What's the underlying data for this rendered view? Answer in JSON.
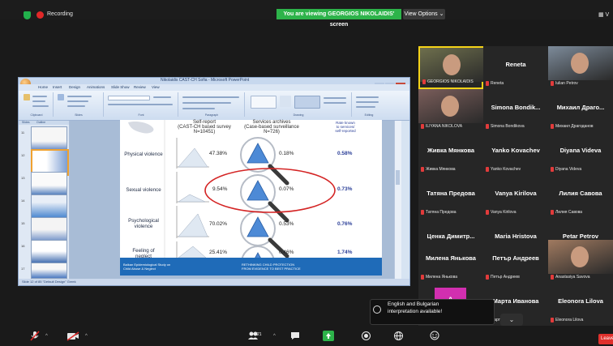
{
  "topbar": {
    "recording_label": "Recording",
    "viewing_banner": "You are viewing GEORGIOS NIKOLAIDIS' screen",
    "view_options": "View Options ⌄",
    "view_right": "▦ V"
  },
  "shared_screen": {
    "window_title": "Nikolaidis CAST-CH Sofia - Microsoft PowerPoint",
    "tabs": [
      "Home",
      "Insert",
      "Design",
      "Animations",
      "Slide Show",
      "Review",
      "View"
    ],
    "ribbon_groups": [
      "Clipboard",
      "Slides",
      "Font",
      "Paragraph",
      "Drawing",
      "Editing"
    ],
    "left_tabs": [
      "Slides",
      "Outline"
    ],
    "thumb_numbers": [
      "11",
      "12",
      "13",
      "14",
      "15",
      "16",
      "17"
    ],
    "status": "Slide 12 of 85   \"Default Design\"   Greek",
    "slide": {
      "col1_title": "Self-report\n(CAST-CH based survey\nN=10451)",
      "col2_title": "Services archives\n(Case-based surveillance\nN=726)",
      "col3_title": "Rate known\nto services/\nself-reported",
      "rows": [
        {
          "label": "Physical violence",
          "self": "47.38%",
          "services": "0.18%",
          "rate": "0.58%"
        },
        {
          "label": "Sexual violence",
          "self": "9.54%",
          "services": "0.07%",
          "rate": "0.73%"
        },
        {
          "label": "Psychological\nviolence",
          "self": "70.02%",
          "services": "0.53%",
          "rate": "0.76%"
        },
        {
          "label": "Feeling of\nneglect",
          "self": "25.41%",
          "services": "0.46%",
          "rate": "1.74%"
        }
      ],
      "footer_left": "Balkan Epidemiological Study on\nChild Abuse & Neglect",
      "footer_right": "RETHINKING CHILD PROTECTION\nFROM EVIDENCE TO BEST PRACTICE"
    }
  },
  "participants": [
    {
      "name": "",
      "small": "GEORGIOS NIKOLAIDIS",
      "photo": true
    },
    {
      "name": "Reneta",
      "small": "Reneta"
    },
    {
      "name": "",
      "small": "Iulian Petrov",
      "photo": true
    },
    {
      "name": "",
      "small": "ILIYANA NIKOLOVA",
      "photo": true
    },
    {
      "name": "Simona Bondik...",
      "small": "Simona Bondikova"
    },
    {
      "name": "Михаил Драго...",
      "small": "Михаил Драгоданов"
    },
    {
      "name": "Живка Мянкова",
      "small": "Живка Мянкова"
    },
    {
      "name": "Yanko Kovachev",
      "small": "Yanko Kovachev"
    },
    {
      "name": "Diyana Videva",
      "small": "Diyana Videva"
    },
    {
      "name": "Татяна Предова",
      "small": "Татяна Предова"
    },
    {
      "name": "Vanya Kirilova",
      "small": "Vanya Kirilova"
    },
    {
      "name": "Лилия Савова",
      "small": "Лилия Савова"
    },
    {
      "name": "Ценка Димитр...",
      "small": "Ценка Димитрова"
    },
    {
      "name": "Maria Hristova",
      "small": "Maria Hristova"
    },
    {
      "name": "Petar Petrov",
      "small": "Petar Petrov"
    },
    {
      "name": "Милена Янькова",
      "small": "Милена Янькова"
    },
    {
      "name": "Петър Андреев",
      "small": "Петър Андреев"
    },
    {
      "name": "",
      "small": "Anastasiya Savova",
      "photo": true
    },
    {
      "name": "",
      "small": "",
      "avatar": "A"
    },
    {
      "name": "Марта Иванова",
      "small": "Марта Иванова"
    },
    {
      "name": "Eleonora Lilova",
      "small": "Eleonora Lilova"
    }
  ],
  "popup": {
    "line1": "English and Bulgarian",
    "line2": "interpretation available!"
  },
  "chevron": "⌄",
  "bottombar": {
    "participants_count": "21",
    "leave_label": "Leave"
  },
  "colors": {
    "accent_green": "#2db34a",
    "leave_red": "#e0312d",
    "highlight_circle": "#d42424"
  }
}
